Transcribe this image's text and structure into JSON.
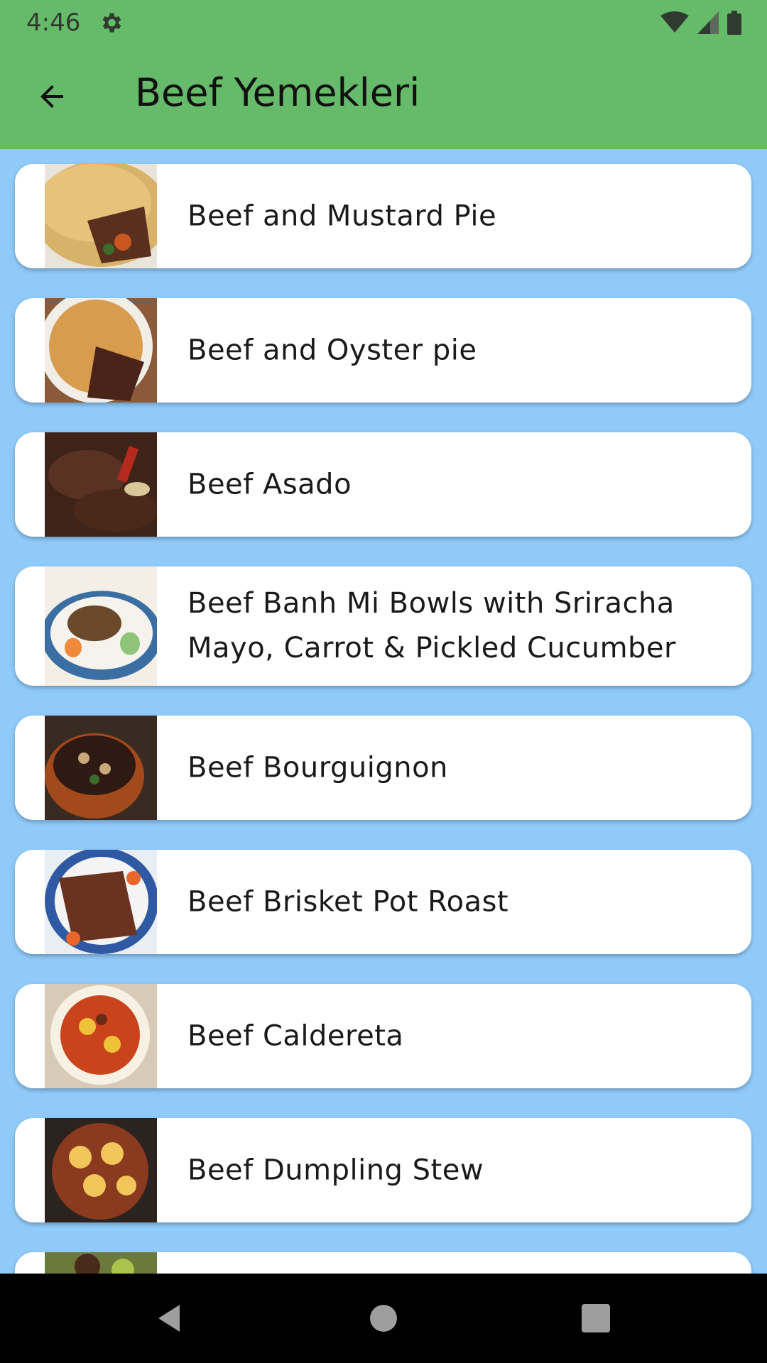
{
  "status": {
    "time": "4:46"
  },
  "appbar": {
    "title": "Beef Yemekleri"
  },
  "recipes": [
    {
      "name": "Beef and Mustard Pie"
    },
    {
      "name": "Beef and Oyster pie"
    },
    {
      "name": "Beef Asado"
    },
    {
      "name": "Beef Banh Mi Bowls with Sriracha Mayo, Carrot & Pickled Cucumber"
    },
    {
      "name": "Beef Bourguignon"
    },
    {
      "name": "Beef Brisket Pot Roast"
    },
    {
      "name": "Beef Caldereta"
    },
    {
      "name": "Beef Dumpling Stew"
    }
  ],
  "colors": {
    "appbar": "#66BB6A",
    "background": "#90CAF9",
    "card": "#FFFFFF"
  },
  "icons": {
    "back": "arrow-back-icon",
    "settings": "gear-icon",
    "wifi": "wifi-icon",
    "signal": "signal-icon",
    "battery": "battery-icon"
  }
}
